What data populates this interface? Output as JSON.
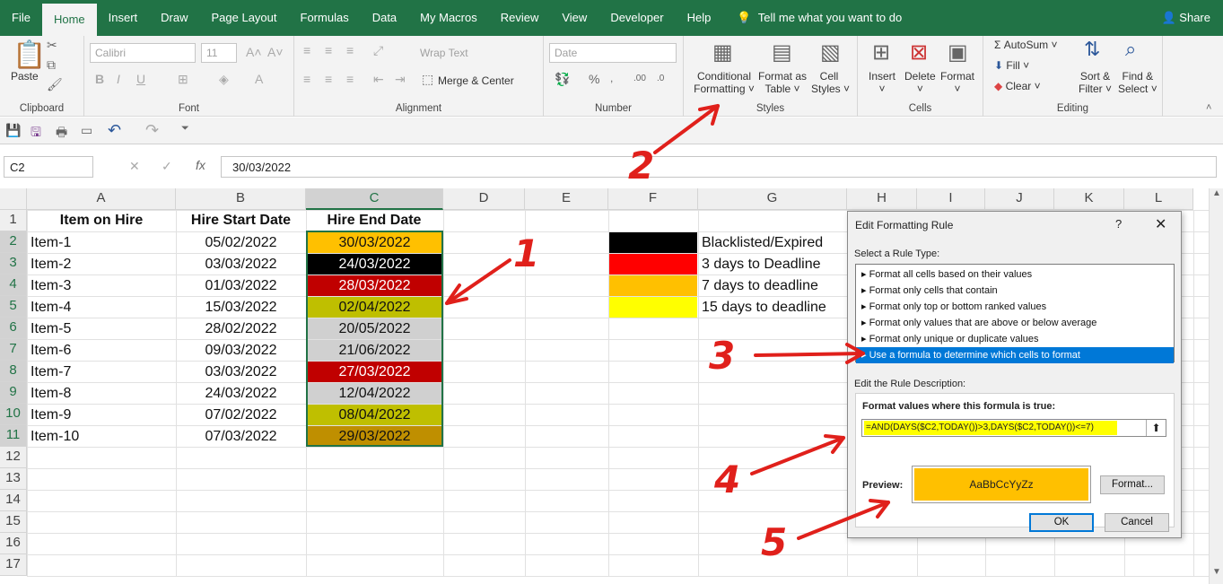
{
  "tabs": [
    "File",
    "Home",
    "Insert",
    "Draw",
    "Page Layout",
    "Formulas",
    "Data",
    "My Macros",
    "Review",
    "View",
    "Developer",
    "Help"
  ],
  "tell_me": "Tell me what you want to do",
  "share": "Share",
  "ribbon": {
    "clipboard": {
      "label": "Clipboard",
      "paste": "Paste"
    },
    "font": {
      "label": "Font",
      "name": "Calibri",
      "size": "11"
    },
    "alignment": {
      "label": "Alignment",
      "wrap": "Wrap Text",
      "merge": "Merge & Center"
    },
    "number": {
      "label": "Number",
      "format": "Date"
    },
    "styles": {
      "label": "Styles",
      "cond1": "Conditional",
      "cond2": "Formatting",
      "fmt1": "Format as",
      "fmt2": "Table",
      "cs1": "Cell",
      "cs2": "Styles"
    },
    "cells": {
      "label": "Cells",
      "insert": "Insert",
      "delete": "Delete",
      "format": "Format"
    },
    "editing": {
      "label": "Editing",
      "autosum": "AutoSum",
      "fill": "Fill",
      "clear": "Clear",
      "sort1": "Sort &",
      "sort2": "Filter",
      "find1": "Find &",
      "find2": "Select"
    }
  },
  "formula_bar": {
    "name_box": "C2",
    "value": "30/03/2022"
  },
  "columns": [
    "A",
    "B",
    "C",
    "D",
    "E",
    "F",
    "G",
    "H",
    "I",
    "J",
    "K",
    "L"
  ],
  "rows": [
    "1",
    "2",
    "3",
    "4",
    "5",
    "6",
    "7",
    "8",
    "9",
    "10",
    "11",
    "12",
    "13",
    "14",
    "15",
    "16",
    "17"
  ],
  "headers": {
    "a": "Item on Hire",
    "b": "Hire Start Date",
    "c": "Hire End Date"
  },
  "table": [
    {
      "item": "Item-1",
      "start": "05/02/2022",
      "end": "30/03/2022",
      "color": "#ffc000",
      "text": "#111111"
    },
    {
      "item": "Item-2",
      "start": "03/03/2022",
      "end": "24/03/2022",
      "color": "#000000",
      "text": "#ffffff"
    },
    {
      "item": "Item-3",
      "start": "01/03/2022",
      "end": "28/03/2022",
      "color": "#c00000",
      "text": "#ffffff"
    },
    {
      "item": "Item-4",
      "start": "15/03/2022",
      "end": "02/04/2022",
      "color": "#bfbf00",
      "text": "#111111"
    },
    {
      "item": "Item-5",
      "start": "28/02/2022",
      "end": "20/05/2022",
      "color": "#d0d0d0",
      "text": "#111111"
    },
    {
      "item": "Item-6",
      "start": "09/03/2022",
      "end": "21/06/2022",
      "color": "#d0d0d0",
      "text": "#111111"
    },
    {
      "item": "Item-7",
      "start": "03/03/2022",
      "end": "27/03/2022",
      "color": "#c00000",
      "text": "#ffffff"
    },
    {
      "item": "Item-8",
      "start": "24/03/2022",
      "end": "12/04/2022",
      "color": "#d0d0d0",
      "text": "#111111"
    },
    {
      "item": "Item-9",
      "start": "07/02/2022",
      "end": "08/04/2022",
      "color": "#bfbf00",
      "text": "#111111"
    },
    {
      "item": "Item-10",
      "start": "07/03/2022",
      "end": "29/03/2022",
      "color": "#bf8f00",
      "text": "#111111"
    }
  ],
  "legend": [
    {
      "color": "#000000",
      "label": "Blacklisted/Expired"
    },
    {
      "color": "#ff0000",
      "label": "3 days to Deadline"
    },
    {
      "color": "#ffc000",
      "label": "7 days to deadline"
    },
    {
      "color": "#ffff00",
      "label": "15 days to deadline"
    }
  ],
  "dialog": {
    "title": "Edit Formatting Rule",
    "help": "?",
    "select_label": "Select a Rule Type:",
    "rules": [
      "Format all cells based on their values",
      "Format only cells that contain",
      "Format only top or bottom ranked values",
      "Format only values that are above or below average",
      "Format only unique or duplicate values",
      "Use a formula to determine which cells to format"
    ],
    "desc_label": "Edit the Rule Description:",
    "formula_label": "Format values where this formula is true:",
    "formula": "=AND(DAYS($C2,TODAY())>3,DAYS($C2,TODAY())<=7)",
    "preview_label": "Preview:",
    "preview_text": "AaBbCcYyZz",
    "preview_color": "#ffc000",
    "format_btn": "Format...",
    "ok": "OK",
    "cancel": "Cancel"
  },
  "annotations": [
    "1",
    "2",
    "3",
    "4",
    "5"
  ]
}
